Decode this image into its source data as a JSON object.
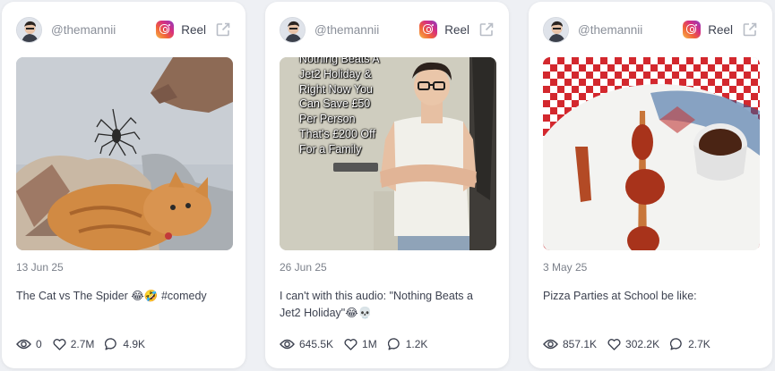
{
  "colors": {
    "text_primary": "#3d4250",
    "text_muted": "#7b808a",
    "card_bg": "#ffffff",
    "page_bg": "#eef0f4"
  },
  "cards": [
    {
      "handle": "@themannii",
      "platform_label": "Reel",
      "platform_icon": "instagram-icon",
      "external_icon": "external-link-icon",
      "thumbnail": "cat-and-spider-photo",
      "date": "13 Jun 25",
      "caption": "The Cat vs The Spider 😂🤣 #comedy",
      "stats": {
        "views": "0",
        "likes": "2.7M",
        "comments": "4.9K"
      }
    },
    {
      "handle": "@themannii",
      "platform_label": "Reel",
      "platform_icon": "instagram-icon",
      "external_icon": "external-link-icon",
      "thumbnail": "man-in-vest-with-overlay-text",
      "overlay_text": "Nothing Beats A Jet2 Holiday & Right Now You Can Save £50 Per Person That's £200 Off For a Family",
      "date": "26 Jun 25",
      "caption": "I can't with this audio: \"Nothing Beats a Jet2 Holiday\"😂💀",
      "stats": {
        "views": "645.5K",
        "likes": "1M",
        "comments": "1.2K"
      }
    },
    {
      "handle": "@themannii",
      "platform_label": "Reel",
      "platform_icon": "instagram-icon",
      "external_icon": "external-link-icon",
      "thumbnail": "pizza-plate-photo",
      "date": "3 May 25",
      "caption": "Pizza Parties at School be like:",
      "stats": {
        "views": "857.1K",
        "likes": "302.2K",
        "comments": "2.7K"
      }
    }
  ]
}
